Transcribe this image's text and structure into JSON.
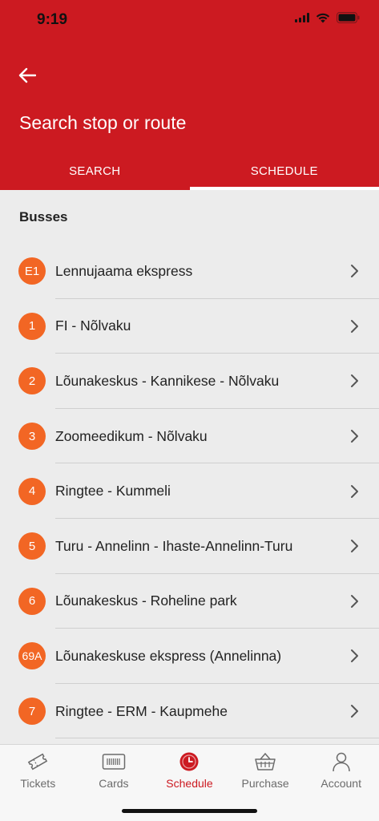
{
  "status": {
    "time": "9:19"
  },
  "header": {
    "title": "Search stop or route"
  },
  "tabs": [
    {
      "label": "SEARCH",
      "active": false
    },
    {
      "label": "SCHEDULE",
      "active": true
    }
  ],
  "section": {
    "title": "Busses"
  },
  "routes": [
    {
      "badge": "E1",
      "name": "Lennujaama ekspress"
    },
    {
      "badge": "1",
      "name": "FI - Nõlvaku"
    },
    {
      "badge": "2",
      "name": "Lõunakeskus - Kannikese - Nõlvaku"
    },
    {
      "badge": "3",
      "name": "Zoomeedikum - Nõlvaku"
    },
    {
      "badge": "4",
      "name": "Ringtee - Kummeli"
    },
    {
      "badge": "5",
      "name": "Turu - Annelinn - Ihaste-Annelinn-Turu"
    },
    {
      "badge": "6",
      "name": "Lõunakeskus - Roheline park"
    },
    {
      "badge": "69A",
      "name": "Lõunakeskuse ekspress (Annelinna)"
    },
    {
      "badge": "7",
      "name": "Ringtee - ERM - Kaupmehe"
    }
  ],
  "tabbar": [
    {
      "label": "Tickets",
      "icon": "ticket-icon",
      "active": false
    },
    {
      "label": "Cards",
      "icon": "card-icon",
      "active": false
    },
    {
      "label": "Schedule",
      "icon": "clock-icon",
      "active": true
    },
    {
      "label": "Purchase",
      "icon": "basket-icon",
      "active": false
    },
    {
      "label": "Account",
      "icon": "person-icon",
      "active": false
    }
  ],
  "colors": {
    "brand_red": "#cc1a21",
    "badge_orange": "#f26624"
  }
}
